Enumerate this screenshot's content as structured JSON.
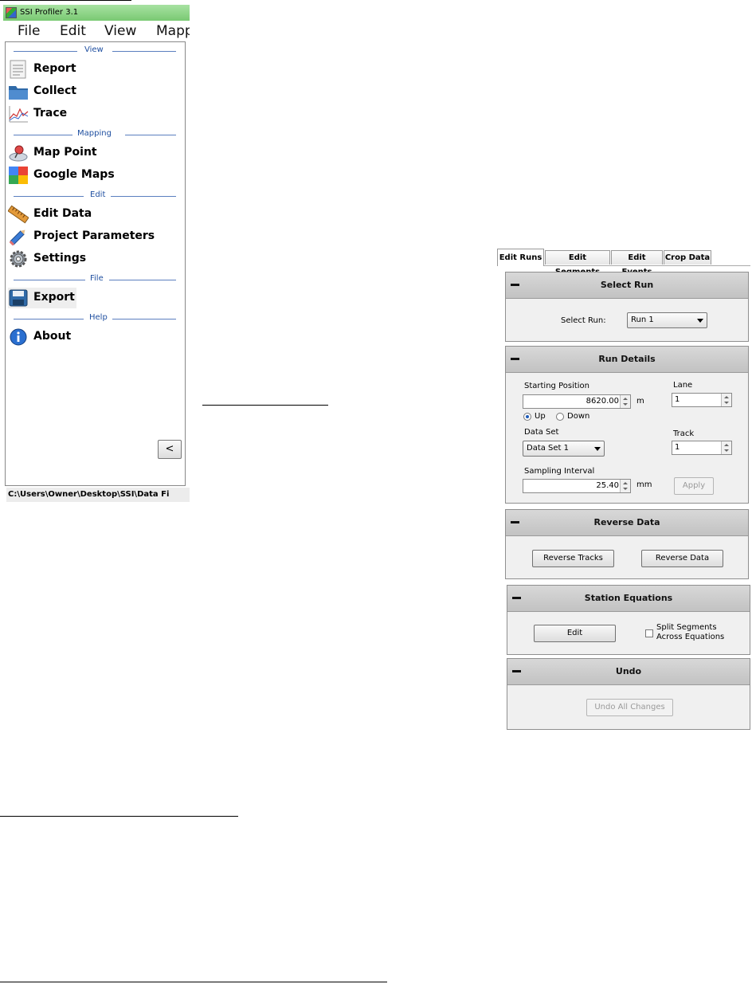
{
  "app": {
    "title": "SSI Profiler 3.1",
    "menu": [
      "File",
      "Edit",
      "View",
      "Mapp"
    ],
    "sections": {
      "view": "View",
      "mapping": "Mapping",
      "edit": "Edit",
      "file": "File",
      "help": "Help"
    },
    "nav": {
      "report": "Report",
      "collect": "Collect",
      "trace": "Trace",
      "map_point": "Map Point",
      "google_maps": "Google Maps",
      "edit_data": "Edit Data",
      "project_parameters": "Project Parameters",
      "settings": "Settings",
      "export": "Export",
      "about": "About"
    },
    "collapse_label": "<",
    "status_path": "C:\\Users\\Owner\\Desktop\\SSI\\Data Fi"
  },
  "panel": {
    "tabs": [
      "Edit Runs",
      "Edit Segments",
      "Edit Events",
      "Crop Data"
    ],
    "select_run": {
      "title": "Select Run",
      "label": "Select Run:",
      "value": "Run 1"
    },
    "run_details": {
      "title": "Run Details",
      "starting_position_label": "Starting Position",
      "starting_position_value": "8620.00",
      "starting_position_unit": "m",
      "lane_label": "Lane",
      "lane_value": "1",
      "direction_up": "Up",
      "direction_down": "Down",
      "data_set_label": "Data Set",
      "data_set_value": "Data Set 1",
      "track_label": "Track",
      "track_value": "1",
      "sampling_interval_label": "Sampling Interval",
      "sampling_interval_value": "25.40",
      "sampling_interval_unit": "mm",
      "apply_label": "Apply"
    },
    "reverse_data": {
      "title": "Reverse Data",
      "reverse_tracks_label": "Reverse Tracks",
      "reverse_data_label": "Reverse Data"
    },
    "station_equations": {
      "title": "Station Equations",
      "edit_label": "Edit",
      "split_line1": "Split Segments",
      "split_line2": "Across Equations"
    },
    "undo": {
      "title": "Undo",
      "undo_all_label": "Undo All Changes"
    }
  },
  "colors": {
    "titlebar": "#79c972",
    "section_text": "#1f4fa0",
    "header_gray": "#c8c8c8"
  }
}
